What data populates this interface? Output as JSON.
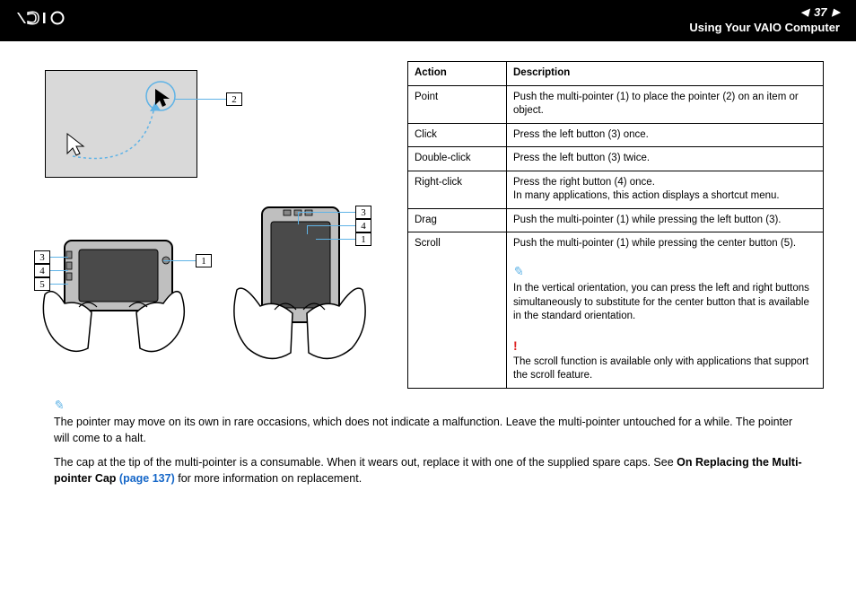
{
  "header": {
    "logo_text": "VAIO",
    "page_number": "37",
    "section": "Using Your VAIO Computer"
  },
  "figure": {
    "callouts": {
      "c2": "2",
      "c1a": "1",
      "c3a": "3",
      "c4a": "4",
      "c5a": "5",
      "c1b": "1",
      "c3b": "3",
      "c4b": "4"
    }
  },
  "table": {
    "head": {
      "action": "Action",
      "desc": "Description"
    },
    "rows": [
      {
        "action": "Point",
        "desc": "Push the multi-pointer (1) to place the pointer (2) on an item or object."
      },
      {
        "action": "Click",
        "desc": "Press the left button (3) once."
      },
      {
        "action": "Double-click",
        "desc": "Press the left button (3) twice."
      },
      {
        "action": "Right-click",
        "desc": "Press the right button (4) once.\nIn many applications, this action displays a shortcut menu."
      },
      {
        "action": "Drag",
        "desc": "Push the multi-pointer (1) while pressing the left button (3)."
      },
      {
        "action": "Scroll",
        "desc": "Push the multi-pointer (1) while pressing the center button (5).",
        "note": "In the vertical orientation, you can press the left and right buttons simultaneously to substitute for the center button that is available in the standard orientation.",
        "warn": "The scroll function is available only with applications that support the scroll feature."
      }
    ]
  },
  "notes": {
    "p1": "The pointer may move on its own in rare occasions, which does not indicate a malfunction. Leave the multi-pointer untouched for a while. The pointer will come to a halt.",
    "p2a": "The cap at the tip of the multi-pointer is a consumable. When it wears out, replace it with one of the supplied spare caps. See ",
    "xref": "On Replacing the Multi-pointer Cap ",
    "xref_page": "(page 137)",
    "p2b": " for more information on replacement."
  }
}
